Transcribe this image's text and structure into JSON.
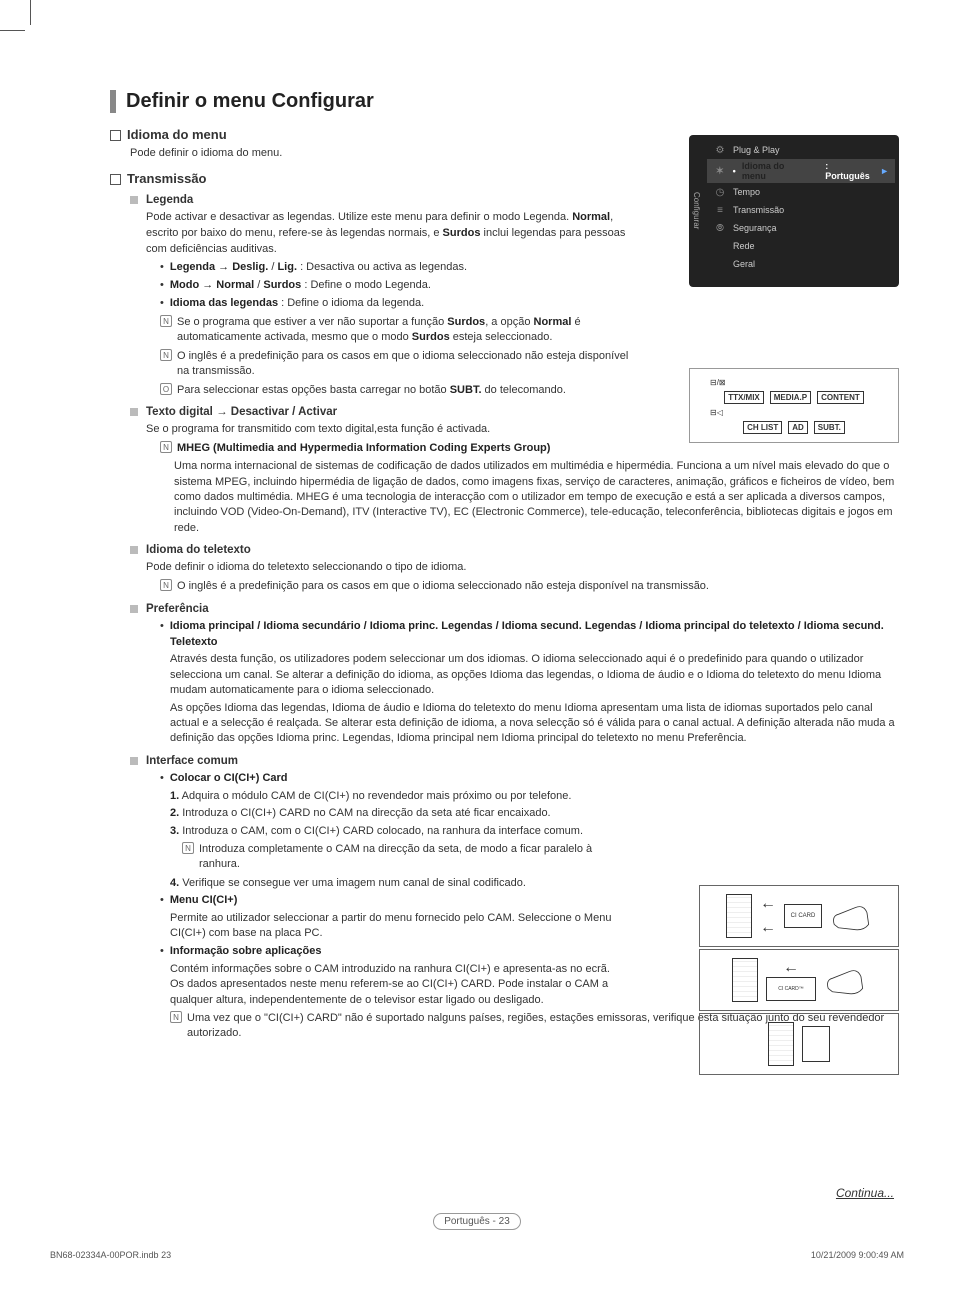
{
  "page": {
    "title": "Definir o menu Configurar",
    "continue": "Continua...",
    "pageLabel": "Português - 23",
    "printFile": "BN68-02334A-00POR.indb   23",
    "printTime": "10/21/2009   9:00:49 AM"
  },
  "s1": {
    "title": "Idioma do menu",
    "desc": "Pode definir o idioma do menu."
  },
  "s2": {
    "title": "Transmissão",
    "legenda": {
      "head": "Legenda",
      "p1a": "Pode activar e desactivar as legendas. Utilize este menu para definir o modo Legenda. ",
      "p1b": "Normal",
      "p1c": ", escrito por baixo do menu, refere-se às legendas normais, e ",
      "p1d": "Surdos",
      "p1e": " inclui legendas para pessoas com deficiências auditivas.",
      "b1": "Legenda → Deslig. / Lig. : Desactiva ou activa as legendas.",
      "b2": "Modo → Normal / Surdos : Define o modo Legenda.",
      "b3": "Idioma das legendas : Define o idioma da legenda.",
      "n1": "Se o programa que estiver a ver não suportar a função Surdos, a opção Normal é automaticamente activada, mesmo que o modo Surdos esteja seleccionado.",
      "n2": "O inglês é a predefinição para os casos em que o idioma seleccionado não esteja disponível na transmissão.",
      "n3": "Para seleccionar estas opções basta carregar no botão SUBT. do telecomando."
    },
    "texto": {
      "head": "Texto digital → Desactivar / Activar",
      "p1": "Se o programa for transmitido com texto digital,esta função é activada.",
      "mhegHead": "MHEG (Multimedia and Hypermedia Information Coding Experts Group)",
      "mheg": "Uma norma internacional de sistemas de codificação de dados utilizados em multimédia e hipermédia. Funciona a um nível mais elevado do que o sistema MPEG, incluindo hipermédia de ligação de dados, como imagens fixas, serviço de caracteres, animação, gráficos e ficheiros de vídeo, bem como dados multimédia. MHEG é uma tecnologia de interacção com o utilizador em tempo de execução e está a ser aplicada a diversos campos, incluindo VOD (Video-On-Demand), ITV (Interactive TV), EC (Electronic Commerce), tele-educação, teleconferência, bibliotecas digitais e jogos em rede."
    },
    "teletexto": {
      "head": "Idioma do teletexto",
      "p1": "Pode definir o idioma do teletexto seleccionando o tipo de idioma.",
      "n1": "O inglês é a predefinição para os casos em que o idioma seleccionado não esteja disponível na transmissão."
    },
    "pref": {
      "head": "Preferência",
      "bhead": "Idioma principal / Idioma secundário / Idioma princ. Legendas / Idioma secund. Legendas / Idioma principal do teletexto / Idioma secund. Teletexto",
      "p1": "Através desta função, os utilizadores podem seleccionar um dos idiomas. O idioma seleccionado aqui é o predefinido para quando o utilizador selecciona um canal. Se alterar a definição do idioma, as opções Idioma das legendas, o Idioma de áudio e o Idioma do teletexto do menu Idioma mudam automaticamente para o idioma seleccionado.",
      "p2": "As opções Idioma das legendas, Idioma de áudio e Idioma do teletexto do menu Idioma apresentam uma lista de idiomas suportados pelo canal actual e a selecção é realçada. Se alterar esta definição de idioma, a nova selecção só é válida para o canal actual. A definição alterada não muda a definição das opções Idioma princ. Legendas, Idioma principal nem Idioma principal do teletexto no menu Preferência."
    },
    "ci": {
      "head": "Interface comum",
      "b1head": "Colocar o CI(CI+) Card",
      "step1": "1. Adquira o módulo CAM de CI(CI+) no revendedor mais próximo ou por telefone.",
      "step2": "2. Introduza o CI(CI+) CARD no CAM na direcção da seta até ficar encaixado.",
      "step3": "3. Introduza o CAM, com o CI(CI+) CARD colocado, na ranhura da interface comum.",
      "step3n": "Introduza completamente o CAM na direcção da seta, de modo a ficar paralelo à ranhura.",
      "step4": "4. Verifique se consegue ver uma imagem num canal de sinal codificado.",
      "b2head": "Menu CI(CI+)",
      "b2p": "Permite ao utilizador seleccionar a partir do menu fornecido pelo CAM. Seleccione o Menu CI(CI+) com base na placa PC.",
      "b3head": "Informação sobre aplicações",
      "b3p": "Contém informações sobre o CAM introduzido na ranhura CI(CI+) e apresenta-as no ecrã. Os dados apresentados neste menu referem-se ao CI(CI+) CARD. Pode instalar o CAM a qualquer altura, independentemente de o televisor estar ligado ou desligado.",
      "b3n": "Uma vez que o \"CI(CI+) CARD\" não é suportado nalguns países, regiões, estações emissoras, verifique esta situação junto do seu revendedor autorizado."
    }
  },
  "osd": {
    "sideLabel": "Configurar",
    "items": [
      "Plug & Play",
      "Idioma do menu",
      "Tempo",
      "Transmissão",
      "Segurança",
      "Rede",
      "Geral"
    ],
    "selValue": ": Português",
    "arrow": "►"
  },
  "remote": {
    "row1": [
      "TTX/MIX",
      "MEDIA.P",
      "CONTENT"
    ],
    "row2": [
      "CH LIST",
      "AD",
      "SUBT."
    ]
  },
  "ciFig": {
    "card": "CI CARD"
  }
}
